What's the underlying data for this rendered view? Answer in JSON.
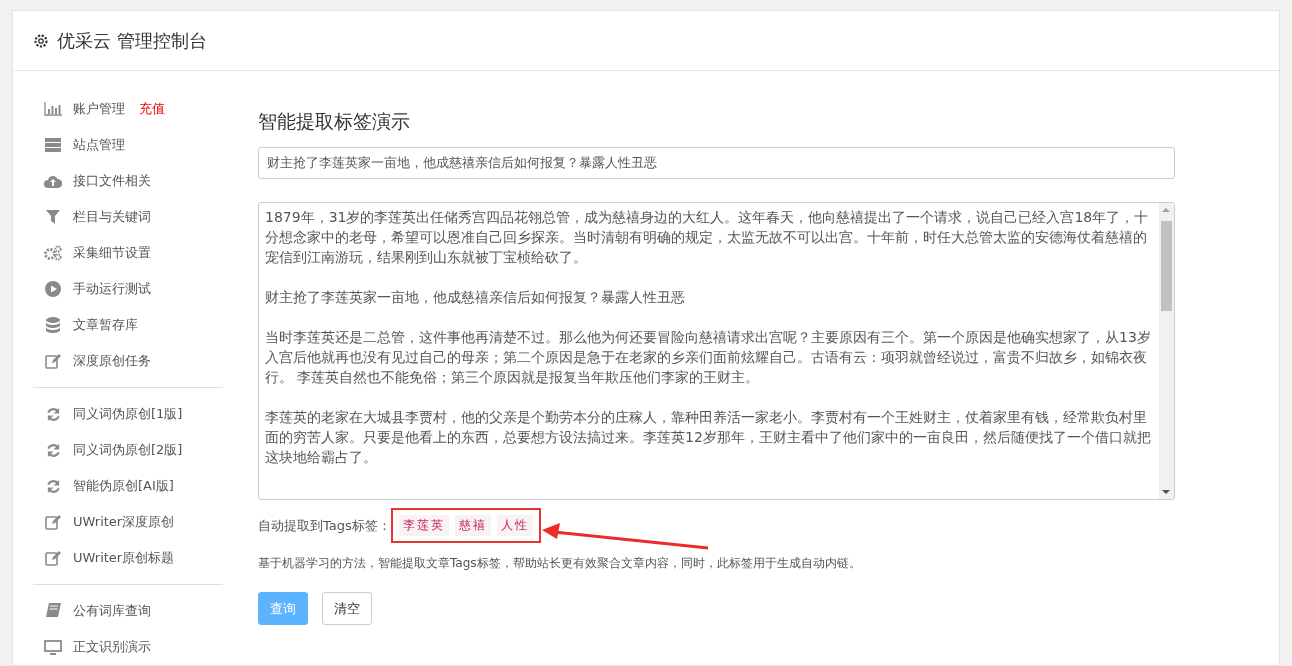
{
  "header": {
    "title": "优采云 管理控制台"
  },
  "sidebar": {
    "groups": [
      [
        {
          "label": "账户管理",
          "badge": "充值"
        },
        {
          "label": "站点管理"
        },
        {
          "label": "接口文件相关"
        },
        {
          "label": "栏目与关键词"
        },
        {
          "label": "采集细节设置"
        },
        {
          "label": "手动运行测试"
        },
        {
          "label": "文章暂存库"
        },
        {
          "label": "深度原创任务"
        }
      ],
      [
        {
          "label": "同义词伪原创[1版]"
        },
        {
          "label": "同义词伪原创[2版]"
        },
        {
          "label": "智能伪原创[AI版]"
        },
        {
          "label": "UWriter深度原创"
        },
        {
          "label": "UWriter原创标题"
        }
      ],
      [
        {
          "label": "公有词库查询"
        },
        {
          "label": "正文识别演示"
        }
      ]
    ]
  },
  "main": {
    "heading": "智能提取标签演示",
    "title_field": {
      "value": "财主抢了李莲英家一亩地，他成慈禧亲信后如何报复？暴露人性丑恶"
    },
    "content_field": {
      "paragraphs": [
        "1879年，31岁的李莲英出任储秀宫四品花翎总管，成为慈禧身边的大红人。这年春天，他向慈禧提出了一个请求，说自己已经入宫18年了，十分想念家中的老母，希望可以恩准自己回乡探亲。当时清朝有明确的规定，太监无故不可以出宫。十年前，时任大总管太监的安德海仗着慈禧的宠信到江南游玩，结果刚到山东就被丁宝桢给砍了。",
        "财主抢了李莲英家一亩地，他成慈禧亲信后如何报复？暴露人性丑恶",
        "当时李莲英还是二总管，这件事他再清楚不过。那么他为何还要冒险向慈禧请求出宫呢？主要原因有三个。第一个原因是他确实想家了，从13岁入宫后他就再也没有见过自己的母亲；第二个原因是急于在老家的乡亲们面前炫耀自己。古语有云：项羽就曾经说过，富贵不归故乡，如锦衣夜行。 李莲英自然也不能免俗；第三个原因就是报复当年欺压他们李家的王财主。",
        "李莲英的老家在大城县李贾村，他的父亲是个勤劳本分的庄稼人，靠种田养活一家老小。李贾村有一个王姓财主，仗着家里有钱，经常欺负村里面的穷苦人家。只要是他看上的东西，总要想方设法搞过来。李莲英12岁那年，王财主看中了他们家中的一亩良田，然后随便找了一个借口就把这块地给霸占了。"
      ]
    },
    "tags": {
      "label": "自动提取到Tags标签：",
      "items": [
        "李莲英",
        "慈禧",
        "人性"
      ]
    },
    "description": "基于机器学习的方法，智能提取文章Tags标签，帮助站长更有效聚合文章内容，同时，此标签用于生成自动内链。",
    "buttons": [
      {
        "label": "查询",
        "kind": "primary"
      },
      {
        "label": "清空",
        "kind": "default"
      }
    ]
  }
}
